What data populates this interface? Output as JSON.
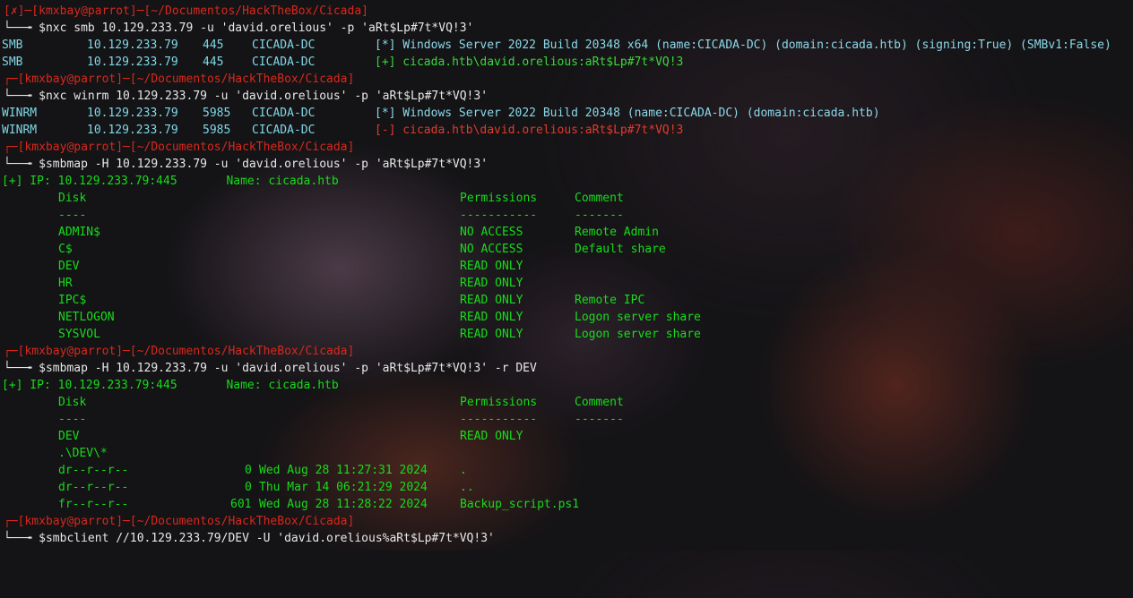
{
  "lines": {
    "p1_host": "[✗]─[kmxbay@parrot]─[~/Documentos/HackTheBox/Cicada]",
    "p1_cmd": "└──╼ $nxc smb 10.129.233.79 -u 'david.orelious' -p 'aRt$Lp#7t*VQ!3'",
    "smb1_proto": "SMB",
    "smb1_ip": "10.129.233.79",
    "smb1_port": "445",
    "smb1_host": "CICADA-DC",
    "smb1_msg": "[*] Windows Server 2022 Build 20348 x64 (name:CICADA-DC) (domain:cicada.htb) (signing:True) (SMBv1:False)",
    "smb2_proto": "SMB",
    "smb2_ip": "10.129.233.79",
    "smb2_port": "445",
    "smb2_host": "CICADA-DC",
    "smb2_msg": "[+] cicada.htb\\david.orelious:aRt$Lp#7t*VQ!3",
    "p2_host": "┌─[kmxbay@parrot]─[~/Documentos/HackTheBox/Cicada]",
    "p2_cmd": "└──╼ $nxc winrm 10.129.233.79 -u 'david.orelious' -p 'aRt$Lp#7t*VQ!3'",
    "win1_proto": "WINRM",
    "win1_ip": "10.129.233.79",
    "win1_port": "5985",
    "win1_host": "CICADA-DC",
    "win1_msg": "[*] Windows Server 2022 Build 20348 (name:CICADA-DC) (domain:cicada.htb)",
    "win2_proto": "WINRM",
    "win2_ip": "10.129.233.79",
    "win2_port": "5985",
    "win2_host": "CICADA-DC",
    "win2_msg": "[-] cicada.htb\\david.orelious:aRt$Lp#7t*VQ!3",
    "p3_host": "┌─[kmxbay@parrot]─[~/Documentos/HackTheBox/Cicada]",
    "p3_cmd": "└──╼ $smbmap -H 10.129.233.79 -u 'david.orelious' -p 'aRt$Lp#7t*VQ!3'",
    "ip1": "[+] IP: 10.129.233.79:445       Name: cicada.htb",
    "hdr1_disk": "Disk",
    "hdr1_perm": "Permissions",
    "hdr1_comment": "Comment",
    "sep1_disk": "----",
    "sep1_perm": "-----------",
    "sep1_comment": "-------",
    "shares": [
      {
        "name": "ADMIN$",
        "perm": "NO ACCESS",
        "comment": "Remote Admin"
      },
      {
        "name": "C$",
        "perm": "NO ACCESS",
        "comment": "Default share"
      },
      {
        "name": "DEV",
        "perm": "READ ONLY",
        "comment": ""
      },
      {
        "name": "HR",
        "perm": "READ ONLY",
        "comment": ""
      },
      {
        "name": "IPC$",
        "perm": "READ ONLY",
        "comment": "Remote IPC"
      },
      {
        "name": "NETLOGON",
        "perm": "READ ONLY",
        "comment": "Logon server share"
      },
      {
        "name": "SYSVOL",
        "perm": "READ ONLY",
        "comment": "Logon server share"
      }
    ],
    "p4_host": "┌─[kmxbay@parrot]─[~/Documentos/HackTheBox/Cicada]",
    "p4_cmd": "└──╼ $smbmap -H 10.129.233.79 -u 'david.orelious' -p 'aRt$Lp#7t*VQ!3' -r DEV",
    "ip2": "[+] IP: 10.129.233.79:445       Name: cicada.htb",
    "hdr2_disk": "Disk",
    "hdr2_perm": "Permissions",
    "hdr2_comment": "Comment",
    "sep2_disk": "----",
    "sep2_perm": "-----------",
    "sep2_comment": "-------",
    "dev_name": "DEV",
    "dev_perm": "READ ONLY",
    "dev_path": ".\\DEV\\*",
    "files": [
      {
        "mode": "dr--r--r--",
        "size": "0",
        "date": "Wed Aug 28 11:27:31 2024",
        "name": "."
      },
      {
        "mode": "dr--r--r--",
        "size": "0",
        "date": "Thu Mar 14 06:21:29 2024",
        "name": ".."
      },
      {
        "mode": "fr--r--r--",
        "size": "601",
        "date": "Wed Aug 28 11:28:22 2024",
        "name": "Backup_script.ps1"
      }
    ],
    "p5_host": "┌─[kmxbay@parrot]─[~/Documentos/HackTheBox/Cicada]",
    "p5_cmd": "└──╼ $smbclient //10.129.233.79/DEV -U 'david.orelious%aRt$Lp#7t*VQ!3'"
  },
  "colors": {
    "prompt_bracket": "#d9281b",
    "prompt_user": "#7fd8e6",
    "output_text": "#17dc1a",
    "background": "#141316"
  }
}
